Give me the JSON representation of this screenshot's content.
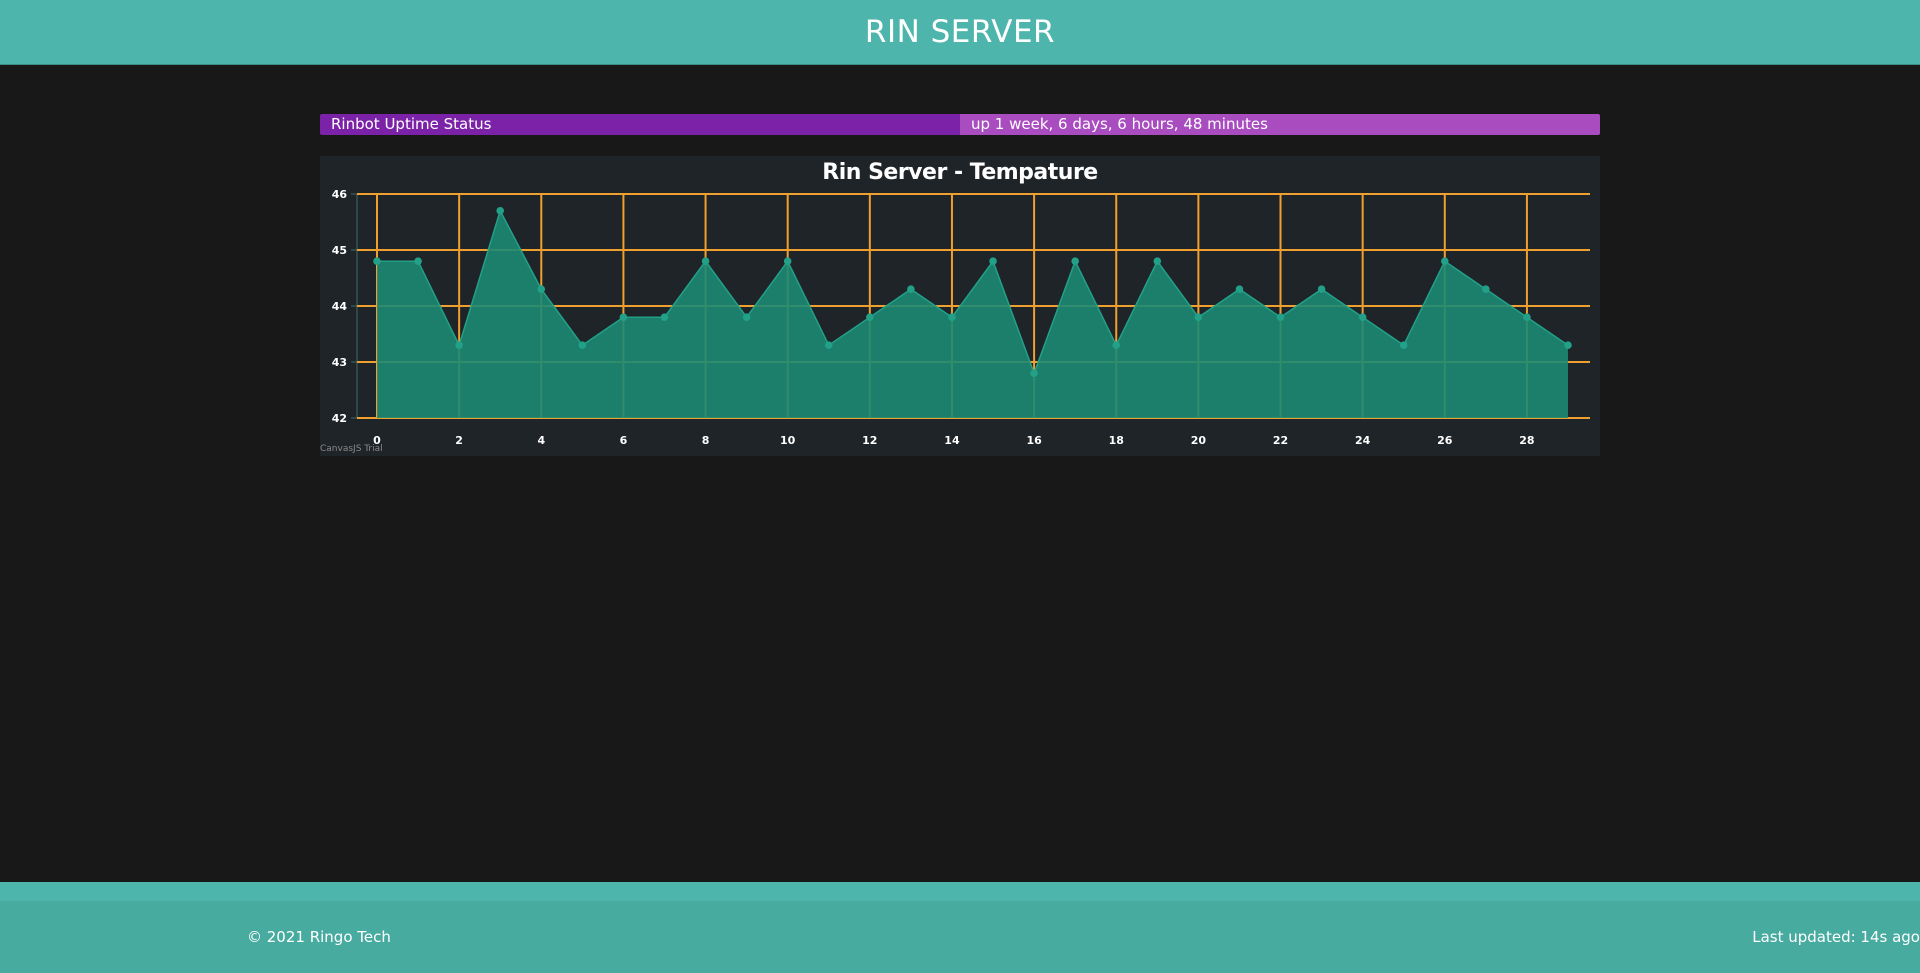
{
  "header": {
    "title": "RIN SERVER"
  },
  "status": {
    "label": "Rinbot Uptime Status",
    "value": "up 1 week, 6 days, 6 hours, 48 minutes"
  },
  "chart_data": {
    "type": "area",
    "title": "Rin Server - Tempature",
    "xlabel": "",
    "ylabel": "",
    "xlim": [
      0,
      29
    ],
    "ylim": [
      42,
      46
    ],
    "x_ticks": [
      0,
      2,
      4,
      6,
      8,
      10,
      12,
      14,
      16,
      18,
      20,
      22,
      24,
      26,
      28
    ],
    "y_ticks": [
      42,
      43,
      44,
      45,
      46
    ],
    "grid": true,
    "x": [
      0,
      1,
      2,
      3,
      4,
      5,
      6,
      7,
      8,
      9,
      10,
      11,
      12,
      13,
      14,
      15,
      16,
      17,
      18,
      19,
      20,
      21,
      22,
      23,
      24,
      25,
      26,
      27,
      28,
      29
    ],
    "values": [
      44.8,
      44.8,
      43.3,
      45.7,
      44.3,
      43.3,
      43.8,
      43.8,
      44.8,
      43.8,
      44.8,
      43.3,
      43.8,
      44.3,
      43.8,
      44.8,
      42.8,
      44.8,
      43.3,
      44.8,
      43.8,
      44.3,
      43.8,
      44.3,
      43.8,
      43.3,
      44.8,
      44.3,
      43.8,
      43.3
    ],
    "colors": {
      "area": "#1b8a73",
      "line": "#22a088",
      "grid": "#f0a02e",
      "panel": "#1f2428"
    },
    "watermark": "CanvasJS Trial"
  },
  "footer": {
    "copyright": "© 2021 Ringo Tech",
    "updated": "Last updated: 14s ago"
  }
}
